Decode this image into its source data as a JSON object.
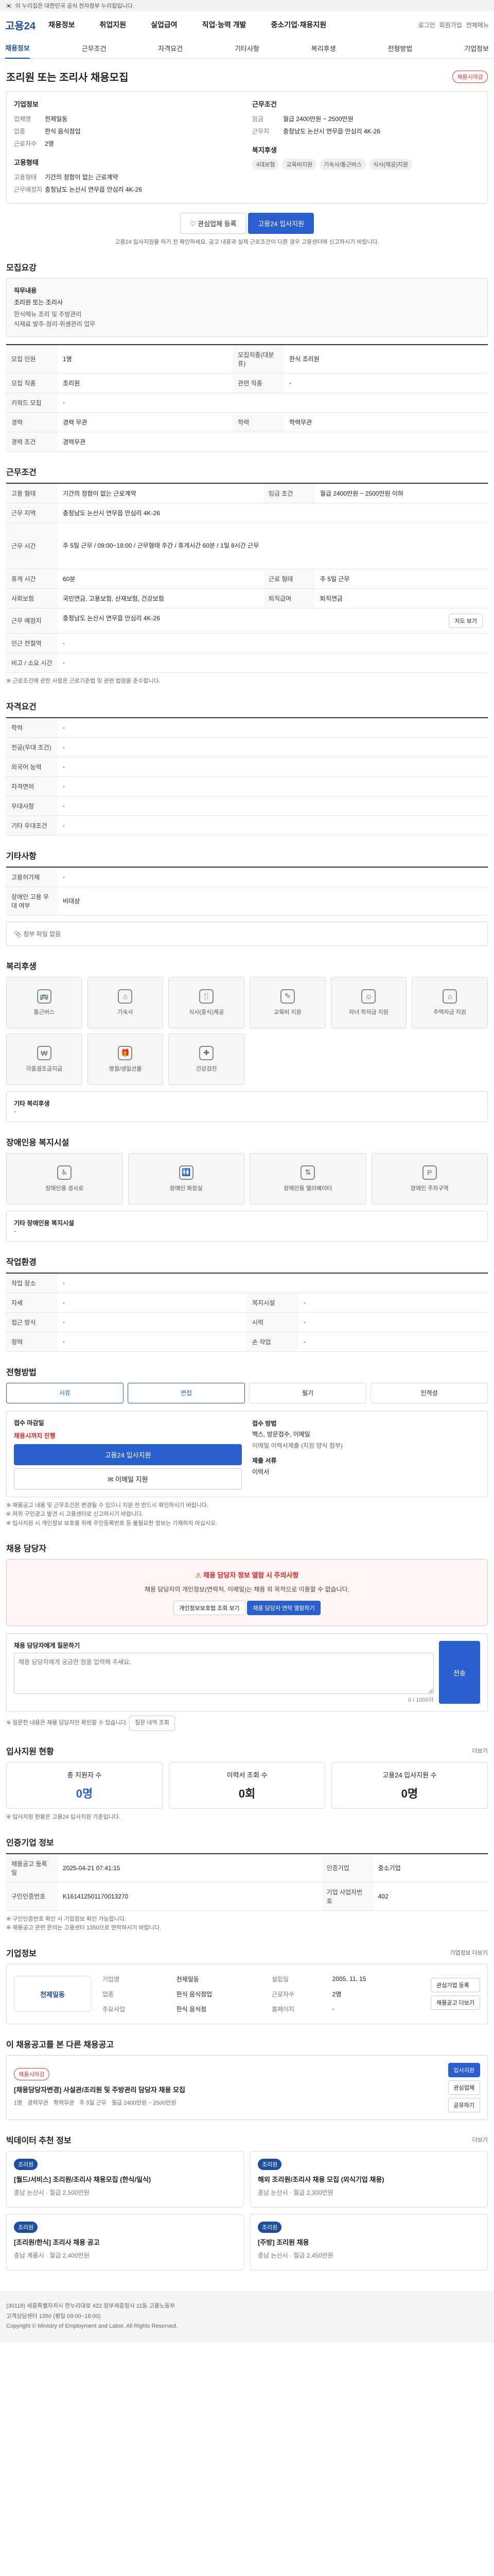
{
  "gov_banner": "이 누리집은 대한민국 공식 전자정부 누리집입니다.",
  "gnb": {
    "logo": "고용24",
    "menu": [
      "채용정보",
      "취업지원",
      "실업급여",
      "직업·능력 개발",
      "중소기업·채용지원"
    ],
    "util": [
      "로그인",
      "회원가입",
      "전체메뉴"
    ]
  },
  "tabs": [
    "채용정보",
    "근무조건",
    "자격요건",
    "기타사항",
    "복리후생",
    "전형방법",
    "기업정보"
  ],
  "job": {
    "title": "조리원 또는 조리사 채용모집",
    "badge": "채용시마감",
    "company_label": "기업정보",
    "company_rows": [
      [
        "업체명",
        "천제일동"
      ],
      [
        "업종",
        "한식 음식점업"
      ],
      [
        "근로자수",
        "2명"
      ]
    ],
    "cond_label": "근무조건",
    "cond_rows": [
      [
        "임금",
        "월급 2400만원 ~ 2500만원"
      ],
      [
        "근무지",
        "충청남도 논산시 연무읍 안심리 4K-26"
      ]
    ],
    "emp_label": "고용형태",
    "emp_rows": [
      [
        "고용형태",
        "기간의 정함이 없는 근로계약"
      ],
      [
        "근무예정지",
        "충청남도 논산시 연무읍 안심리 4K-26"
      ]
    ],
    "welfare_label": "복지후생",
    "welfare_tags": [
      "4대보험",
      "교육비지원",
      "기숙사/통근버스",
      "식사(제공)지원"
    ],
    "btn_fav": "관심업체 등록",
    "btn_apply": "고용24 입사지원",
    "notice": "고용24 입사지원을 하기 전 확인하세요. 공고 내용과 실제 근로조건이 다른 경우 고용센터에 신고하시기 바랍니다."
  },
  "recruit": {
    "h": "모집요강",
    "role_label": "직무내용",
    "role_text": "조리원 또는 조리사",
    "role_desc": "한식메뉴 조리 및 주방관리\n식재료 발주·정리·위생관리 업무",
    "rows": [
      [
        "모집 인원",
        "1명",
        "모집직종(대분류)",
        "한식 조리원"
      ],
      [
        "모집 직종",
        "조리원",
        "관련 직종",
        "-"
      ],
      [
        "키워드 모집",
        "-",
        "",
        ""
      ],
      [
        "경력",
        "경력 무관",
        "학력",
        "학력무관"
      ],
      [
        "경력 조건",
        "경력무관",
        "",
        ""
      ]
    ]
  },
  "work": {
    "h": "근무조건",
    "rows": [
      [
        "고용 형태",
        "기간의 정함이 없는 근로계약",
        "임금 조건",
        "월급 2400만원 ~ 2500만원 이하"
      ],
      [
        "근무 지역",
        "충청남도 논산시 연무읍 안심리 4K-26",
        "",
        ""
      ],
      [
        "근무 시간",
        "주 5일 근무 / 09:00~18:00 / 근무형태 주간 / 휴게시간 60분 / 1일 8시간 근무",
        "",
        ""
      ],
      [
        "휴게 시간",
        "60분",
        "근로 형태",
        "주 5일 근무"
      ],
      [
        "사회보험",
        "국민연금, 고용보험, 산재보험, 건강보험",
        "퇴직급여",
        "퇴직연금"
      ],
      [
        "근무 예정지",
        "충청남도 논산시 연무읍 안심리 4K-26",
        "",
        ""
      ],
      [
        "인근 전철역",
        "-",
        "",
        ""
      ],
      [
        "비고 / 소요 시간",
        "-",
        "",
        ""
      ]
    ],
    "map_btn": "지도 보기",
    "note": "※ 근로조건에 관한 사항은 근로기준법 및 관련 법령을 준수합니다."
  },
  "qual": {
    "h": "자격요건",
    "rows": [
      [
        "학력",
        "-"
      ],
      [
        "전공(우대 조건)",
        "-"
      ],
      [
        "외국어 능력",
        "-"
      ],
      [
        "자격면허",
        "-"
      ],
      [
        "우대사항",
        "-"
      ],
      [
        "기타 우대조건",
        "-"
      ]
    ]
  },
  "etc": {
    "h": "기타사항",
    "rows": [
      [
        "고용허가제",
        "-"
      ],
      [
        "장애인 고용 우대 여부",
        "비대상"
      ]
    ],
    "file_label": "첨부 파일 없음"
  },
  "welfare": {
    "h": "복리후생",
    "icons": [
      [
        "bus-icon",
        "통근버스"
      ],
      [
        "dorm-icon",
        "기숙사"
      ],
      [
        "meal-icon",
        "식사(중식)제공"
      ],
      [
        "edu-icon",
        "교육비 지원"
      ],
      [
        "child-icon",
        "자녀 학자금 지원"
      ],
      [
        "leave-icon",
        "주택자금 지원"
      ],
      [
        "pay-icon",
        "각종경조금지급"
      ],
      [
        "gift-icon",
        "명절/생일선물"
      ],
      [
        "health-icon",
        "건강검진"
      ]
    ],
    "other_label": "기타 복리후생",
    "other_val": "-"
  },
  "disab": {
    "h": "장애인용 복지시설",
    "icons": [
      [
        "ramp-icon",
        "장애인용 경사로"
      ],
      [
        "toilet-icon",
        "장애인 화장실"
      ],
      [
        "elevator-icon",
        "장애인용 엘리베이터"
      ],
      [
        "parking-icon",
        "장애인 주차구역"
      ]
    ],
    "other_label": "기타 장애인용 복지시설",
    "other_val": "-"
  },
  "workenv": {
    "h": "작업환경",
    "rows": [
      [
        "작업 장소",
        "-",
        "",
        ""
      ],
      [
        "자세",
        "-",
        "복지시설",
        "-"
      ],
      [
        "접근 방식",
        "-",
        "시력",
        "-"
      ],
      [
        "청력",
        "-",
        "손 작업",
        "-"
      ]
    ]
  },
  "process": {
    "h": "전형방법",
    "steps": [
      "서류",
      "면접",
      "필기",
      "인적성"
    ],
    "deadline_label": "접수 마감일",
    "deadline_val": "채용시까지 진행",
    "method_label": "접수 방법",
    "method_val": "팩스, 방문접수, 이메일",
    "fax": "이메일 이력서제출 (지정 양식 첨부)",
    "doc_label": "제출 서류",
    "doc_val": "이력서",
    "btn_apply": "고용24 입사지원",
    "btn_email": "이메일 지원",
    "notes": [
      "※ 채용공고 내용 및 근무조건은 변경될 수 있으니 지원 전 반드시 확인하시기 바랍니다.",
      "※ 허위 구인광고 발견 시 고용센터로 신고하시기 바랍니다.",
      "※ 입사지원 시 개인정보 보호를 위해 주민등록번호 등 불필요한 정보는 기재하지 마십시오."
    ]
  },
  "contact": {
    "h": "채용 담당자",
    "alert_h": "채용 담당자 정보 열람 시 주의사항",
    "alert_text": "채용 담당자의 개인정보(연락처, 이메일)는 채용 외 목적으로 이용할 수 없습니다.",
    "btn1": "개인정보보호법 조회 보기",
    "btn2": "채용 담당자 연락 열람하기",
    "q_label": "채용 담당자에게 질문하기",
    "q_placeholder": "채용 담당자에게 궁금한 점을 입력해 주세요.",
    "q_count": "0 / 1000자",
    "q_btn": "전송",
    "q_note": "※ 질문한 내용은 채용 담당자만 확인할 수 있습니다.",
    "q_btn2": "질문 내역 조회"
  },
  "apply_status": {
    "h": "입사지원 현황",
    "more": "더보기",
    "cards": [
      [
        "총 지원자 수",
        "0명"
      ],
      [
        "이력서 조회 수",
        "0회"
      ],
      [
        "고용24 입사지원 수",
        "0명"
      ]
    ],
    "note": "※ 입사지원 현황은 고용24 입사지원 기준입니다."
  },
  "info": {
    "h": "인증기업 정보",
    "rows": [
      [
        "채용공고 등록일",
        "2025-04-21 07:41:15",
        "인증기업",
        "중소기업"
      ],
      [
        "구인인증번호",
        "K161412501170013270",
        "기업 사업자번호",
        "402"
      ]
    ],
    "notes": [
      "※ 구인인증번호 확인 시 기업정보 확인 가능합니다.",
      "※ 채용공고 관련 문의는 고용센터 1350으로 연락하시기 바랍니다."
    ]
  },
  "company": {
    "h": "기업정보",
    "more": "기업정보 더보기",
    "logo": "천제일동",
    "rows": [
      [
        "기업명",
        "천제일동",
        "설립일",
        "2005. 11. 15"
      ],
      [
        "업종",
        "한식 음식점업",
        "근로자수",
        "2명"
      ],
      [
        "주요사업",
        "한식 음식점",
        "홈페이지",
        "-"
      ]
    ],
    "btn_fav": "관심기업 등록",
    "btn_all": "채용공고 더보기"
  },
  "similar": {
    "h": "이 채용공고를 본 다른 채용공고",
    "tag": "채용시마감",
    "title": "[채용담당자변경] 사설관/조리원 및 주방관리 담당자 채용 모집",
    "meta": [
      "1명",
      "경력무관",
      "학력무관",
      "주 5일 근무",
      "월급 2400만원 ~ 2500만원"
    ],
    "btns": [
      "입사지원",
      "관심업체",
      "공유하기"
    ]
  },
  "recs": {
    "h": "빅데이터 추천 정보",
    "more": "더보기",
    "items": [
      {
        "tag": "조리원",
        "title": "[월드/서비스] 조리원/조리사 채용모집 (한식/일식)",
        "meta": "충남 논산시 · 월급 2,500만원"
      },
      {
        "tag": "조리원",
        "title": "해외 조리원/조리사 채용 모집 (외식기업 채용)",
        "meta": "충남 논산시 · 월급 2,300만원"
      },
      {
        "tag": "조리원",
        "title": "[조리원/한식] 조리사 채용 공고",
        "meta": "충남 계룡시 · 월급 2,400만원"
      },
      {
        "tag": "조리원",
        "title": "[주방] 조리원 채용",
        "meta": "충남 논산시 · 월급 2,450만원"
      }
    ]
  },
  "footer": {
    "lines": [
      "(30118) 세종특별자치시 한누리대로 422 정부세종청사 11동 고용노동부",
      "고객상담센터 1350 (평일 09:00~18:00)",
      "Copyright © Ministry of Employment and Labor. All Rights Reserved."
    ]
  }
}
